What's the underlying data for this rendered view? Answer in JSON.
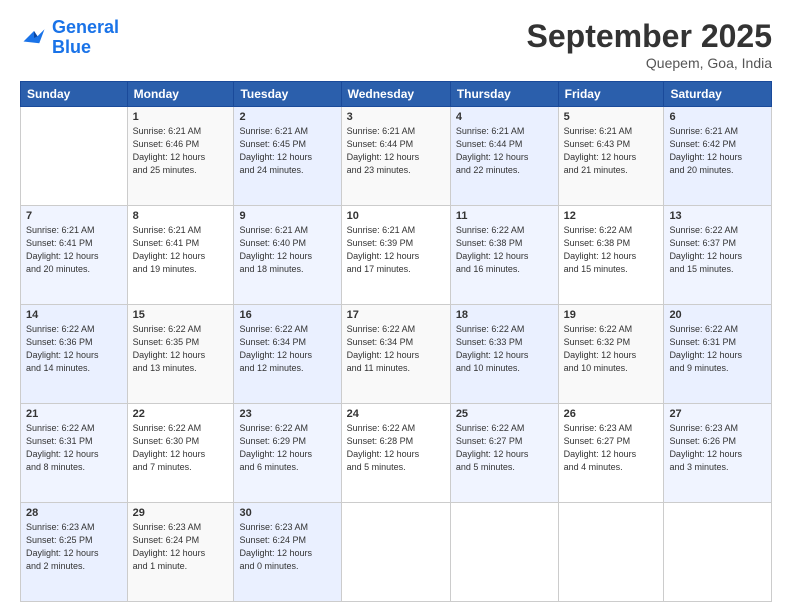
{
  "logo": {
    "line1": "General",
    "line2": "Blue"
  },
  "title": "September 2025",
  "location": "Quepem, Goa, India",
  "days_header": [
    "Sunday",
    "Monday",
    "Tuesday",
    "Wednesday",
    "Thursday",
    "Friday",
    "Saturday"
  ],
  "weeks": [
    [
      {
        "num": "",
        "info": ""
      },
      {
        "num": "1",
        "info": "Sunrise: 6:21 AM\nSunset: 6:46 PM\nDaylight: 12 hours\nand 25 minutes."
      },
      {
        "num": "2",
        "info": "Sunrise: 6:21 AM\nSunset: 6:45 PM\nDaylight: 12 hours\nand 24 minutes."
      },
      {
        "num": "3",
        "info": "Sunrise: 6:21 AM\nSunset: 6:44 PM\nDaylight: 12 hours\nand 23 minutes."
      },
      {
        "num": "4",
        "info": "Sunrise: 6:21 AM\nSunset: 6:44 PM\nDaylight: 12 hours\nand 22 minutes."
      },
      {
        "num": "5",
        "info": "Sunrise: 6:21 AM\nSunset: 6:43 PM\nDaylight: 12 hours\nand 21 minutes."
      },
      {
        "num": "6",
        "info": "Sunrise: 6:21 AM\nSunset: 6:42 PM\nDaylight: 12 hours\nand 20 minutes."
      }
    ],
    [
      {
        "num": "7",
        "info": "Sunrise: 6:21 AM\nSunset: 6:41 PM\nDaylight: 12 hours\nand 20 minutes."
      },
      {
        "num": "8",
        "info": "Sunrise: 6:21 AM\nSunset: 6:41 PM\nDaylight: 12 hours\nand 19 minutes."
      },
      {
        "num": "9",
        "info": "Sunrise: 6:21 AM\nSunset: 6:40 PM\nDaylight: 12 hours\nand 18 minutes."
      },
      {
        "num": "10",
        "info": "Sunrise: 6:21 AM\nSunset: 6:39 PM\nDaylight: 12 hours\nand 17 minutes."
      },
      {
        "num": "11",
        "info": "Sunrise: 6:22 AM\nSunset: 6:38 PM\nDaylight: 12 hours\nand 16 minutes."
      },
      {
        "num": "12",
        "info": "Sunrise: 6:22 AM\nSunset: 6:38 PM\nDaylight: 12 hours\nand 15 minutes."
      },
      {
        "num": "13",
        "info": "Sunrise: 6:22 AM\nSunset: 6:37 PM\nDaylight: 12 hours\nand 15 minutes."
      }
    ],
    [
      {
        "num": "14",
        "info": "Sunrise: 6:22 AM\nSunset: 6:36 PM\nDaylight: 12 hours\nand 14 minutes."
      },
      {
        "num": "15",
        "info": "Sunrise: 6:22 AM\nSunset: 6:35 PM\nDaylight: 12 hours\nand 13 minutes."
      },
      {
        "num": "16",
        "info": "Sunrise: 6:22 AM\nSunset: 6:34 PM\nDaylight: 12 hours\nand 12 minutes."
      },
      {
        "num": "17",
        "info": "Sunrise: 6:22 AM\nSunset: 6:34 PM\nDaylight: 12 hours\nand 11 minutes."
      },
      {
        "num": "18",
        "info": "Sunrise: 6:22 AM\nSunset: 6:33 PM\nDaylight: 12 hours\nand 10 minutes."
      },
      {
        "num": "19",
        "info": "Sunrise: 6:22 AM\nSunset: 6:32 PM\nDaylight: 12 hours\nand 10 minutes."
      },
      {
        "num": "20",
        "info": "Sunrise: 6:22 AM\nSunset: 6:31 PM\nDaylight: 12 hours\nand 9 minutes."
      }
    ],
    [
      {
        "num": "21",
        "info": "Sunrise: 6:22 AM\nSunset: 6:31 PM\nDaylight: 12 hours\nand 8 minutes."
      },
      {
        "num": "22",
        "info": "Sunrise: 6:22 AM\nSunset: 6:30 PM\nDaylight: 12 hours\nand 7 minutes."
      },
      {
        "num": "23",
        "info": "Sunrise: 6:22 AM\nSunset: 6:29 PM\nDaylight: 12 hours\nand 6 minutes."
      },
      {
        "num": "24",
        "info": "Sunrise: 6:22 AM\nSunset: 6:28 PM\nDaylight: 12 hours\nand 5 minutes."
      },
      {
        "num": "25",
        "info": "Sunrise: 6:22 AM\nSunset: 6:27 PM\nDaylight: 12 hours\nand 5 minutes."
      },
      {
        "num": "26",
        "info": "Sunrise: 6:23 AM\nSunset: 6:27 PM\nDaylight: 12 hours\nand 4 minutes."
      },
      {
        "num": "27",
        "info": "Sunrise: 6:23 AM\nSunset: 6:26 PM\nDaylight: 12 hours\nand 3 minutes."
      }
    ],
    [
      {
        "num": "28",
        "info": "Sunrise: 6:23 AM\nSunset: 6:25 PM\nDaylight: 12 hours\nand 2 minutes."
      },
      {
        "num": "29",
        "info": "Sunrise: 6:23 AM\nSunset: 6:24 PM\nDaylight: 12 hours\nand 1 minute."
      },
      {
        "num": "30",
        "info": "Sunrise: 6:23 AM\nSunset: 6:24 PM\nDaylight: 12 hours\nand 0 minutes."
      },
      {
        "num": "",
        "info": ""
      },
      {
        "num": "",
        "info": ""
      },
      {
        "num": "",
        "info": ""
      },
      {
        "num": "",
        "info": ""
      }
    ]
  ]
}
